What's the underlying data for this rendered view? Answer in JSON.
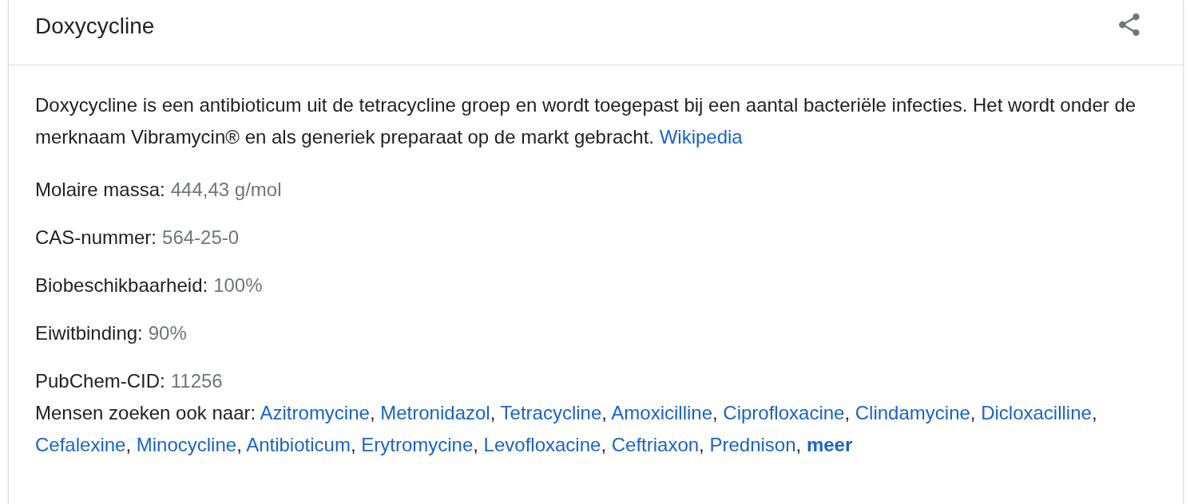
{
  "title": "Doxycycline",
  "description": {
    "text": "Doxycycline is een antibioticum uit de tetracycline groep en wordt toegepast bij een aantal bacteriële infecties. Het wordt onder de merknaam Vibramycin® en als generiek preparaat op de markt gebracht.",
    "source": "Wikipedia"
  },
  "facts": [
    {
      "label": "Molaire massa:",
      "value": "444,43 g/mol"
    },
    {
      "label": "CAS-nummer:",
      "value": "564-25-0"
    },
    {
      "label": "Biobeschikbaarheid:",
      "value": "100%"
    },
    {
      "label": "Eiwitbinding:",
      "value": "90%"
    },
    {
      "label": "PubChem-CID:",
      "value": "11256"
    }
  ],
  "related": {
    "label": "Mensen zoeken ook naar:",
    "items": [
      {
        "label": "Azitromycine",
        "suffix": ",",
        "kind": "link"
      },
      {
        "label": "Metronidazol",
        "suffix": ",",
        "kind": "link"
      },
      {
        "label": "Tetracycline",
        "suffix": ",",
        "kind": "link"
      },
      {
        "label": "Amoxicilline",
        "suffix": ",",
        "kind": "link"
      },
      {
        "label": "Ciprofloxacine",
        "suffix": ",",
        "kind": "link"
      },
      {
        "label": "Clindamycine",
        "suffix": ",",
        "kind": "link"
      },
      {
        "label": "Dicloxacilline",
        "suffix": ",",
        "kind": "link"
      },
      {
        "label": "Cefalexine",
        "suffix": ",",
        "kind": "link"
      },
      {
        "label": "Minocycline",
        "suffix": ",",
        "kind": "link"
      },
      {
        "label": "Antibioticum",
        "suffix": ",",
        "kind": "link"
      },
      {
        "label": "Erytromycine",
        "suffix": ",",
        "kind": "link"
      },
      {
        "label": "Levofloxacine",
        "suffix": ",",
        "kind": "link"
      },
      {
        "label": "Ceftriaxon",
        "suffix": ",",
        "kind": "link"
      },
      {
        "label": "Prednison",
        "suffix": ",",
        "kind": "link"
      },
      {
        "label": "meer",
        "kind": "more"
      }
    ]
  }
}
